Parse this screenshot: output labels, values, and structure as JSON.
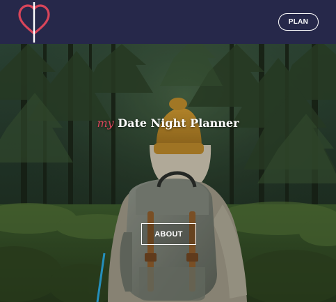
{
  "navbar": {
    "logo_icon": "heart-pin-logo-icon",
    "plan_label": "PLAN"
  },
  "hero": {
    "title_accent": "my",
    "title_main": "Date Night Planner",
    "about_label": "ABOUT",
    "background": "hiker-forest-photo"
  },
  "colors": {
    "navbar_bg": "#26284a",
    "accent": "#d8455a"
  }
}
